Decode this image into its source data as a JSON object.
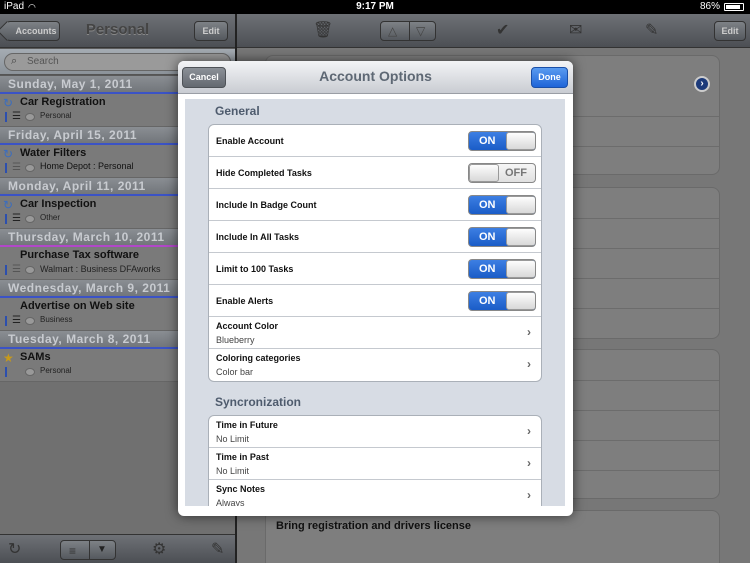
{
  "status": {
    "carrier": "iPad",
    "time": "9:17 PM",
    "battery": "86%"
  },
  "left": {
    "back_label": "Accounts",
    "title": "Personal",
    "edit_label": "Edit",
    "search_placeholder": "Search",
    "sections": [
      {
        "date": "Sunday, May 1, 2011",
        "title": "Car Registration",
        "sub": "Personal"
      },
      {
        "date": "Friday, April 15, 2011",
        "title": "Water Filters",
        "sub": "Home Depot : Personal"
      },
      {
        "date": "Monday, April 11, 2011",
        "title": "Car Inspection",
        "sub": "Other"
      },
      {
        "date": "Thursday, March 10, 2011",
        "title": "Purchase Tax software",
        "sub": "Walmart : Business DFAworks"
      },
      {
        "date": "Wednesday, March 9, 2011",
        "title": "Advertise on Web site",
        "sub": "Business"
      },
      {
        "date": "Tuesday, March 8, 2011",
        "title": "SAMs",
        "sub": "Personal"
      }
    ]
  },
  "right": {
    "edit_label": "Edit",
    "note": "Bring registration and drivers license"
  },
  "modal": {
    "cancel_label": "Cancel",
    "title": "Account Options",
    "done_label": "Done",
    "general_title": "General",
    "on_label": "ON",
    "off_label": "OFF",
    "toggles": [
      {
        "label": "Enable Account",
        "state": "ON"
      },
      {
        "label": "Hide Completed Tasks",
        "state": "OFF"
      },
      {
        "label": "Include In Badge Count",
        "state": "ON"
      },
      {
        "label": "Include In All Tasks",
        "state": "ON"
      },
      {
        "label": "Limit to 100 Tasks",
        "state": "ON"
      },
      {
        "label": "Enable Alerts",
        "state": "ON"
      }
    ],
    "account_color": {
      "label": "Account Color",
      "value": "Blueberry"
    },
    "coloring": {
      "label": "Coloring categories",
      "value": "Color bar"
    },
    "sync_title": "Syncronization",
    "sync": [
      {
        "label": "Time in Future",
        "value": "No Limit"
      },
      {
        "label": "Time in Past",
        "value": "No Limit"
      },
      {
        "label": "Sync Notes",
        "value": "Always"
      }
    ]
  },
  "colors": {
    "toggle_on": "#1a5cc7",
    "done": "#1e64d8",
    "section_title": "#4e5b6d"
  }
}
